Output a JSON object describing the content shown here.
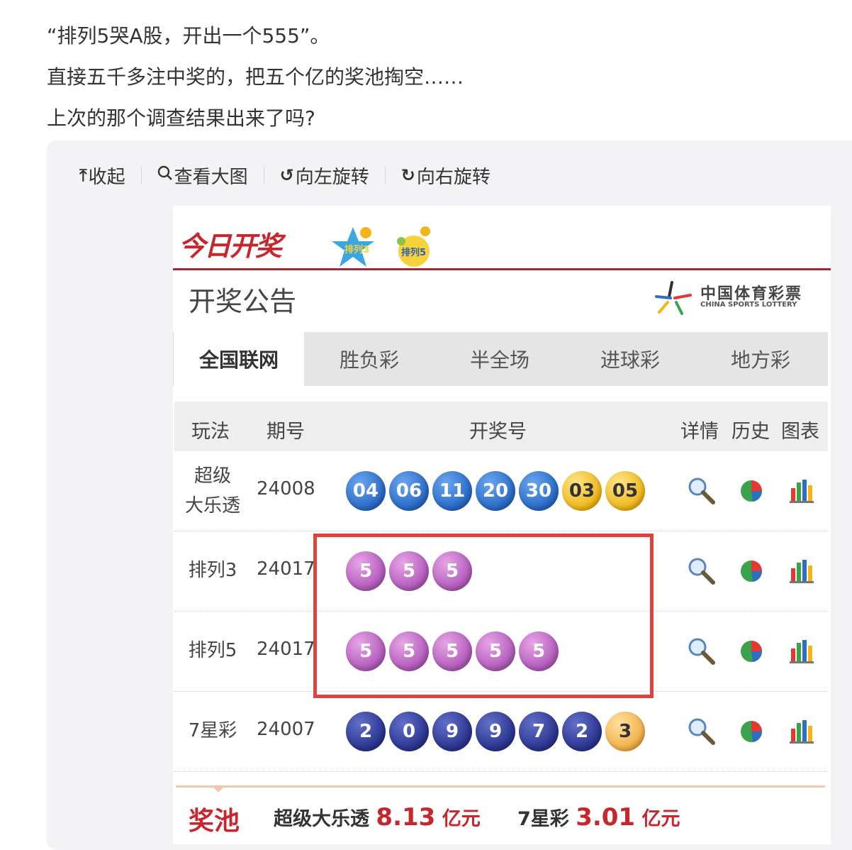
{
  "post": {
    "lines": [
      "“排列5哭A股，开出一个555”。",
      "直接五千多注中奖的，把五个亿的奖池掏空……",
      "上次的那个调查结果出来了吗?"
    ]
  },
  "toolbar": {
    "collapse": "收起",
    "view_large": "查看大图",
    "rotate_left": "向左旋转",
    "rotate_right": "向右旋转"
  },
  "card": {
    "brand": "今日开奖",
    "logo_left": "排列3",
    "logo_right": "排列5",
    "notice_title": "开奖公告",
    "sponsor_cn": "中国体育彩票",
    "sponsor_en": "CHINA SPORTS LOTTERY",
    "tabs": [
      "全国联网",
      "胜负彩",
      "半全场",
      "进球彩",
      "地方彩"
    ],
    "columns": {
      "game": "玩法",
      "issue": "期号",
      "numbers": "开奖号",
      "detail": "详情",
      "history": "历史",
      "chart": "图表"
    },
    "rows": [
      {
        "game_line1": "超级",
        "game_line2": "大乐透",
        "issue": "24008",
        "balls": [
          {
            "n": "04",
            "c": "blue"
          },
          {
            "n": "06",
            "c": "blue"
          },
          {
            "n": "11",
            "c": "blue"
          },
          {
            "n": "20",
            "c": "blue"
          },
          {
            "n": "30",
            "c": "blue"
          },
          {
            "n": "03",
            "c": "gold"
          },
          {
            "n": "05",
            "c": "gold"
          }
        ]
      },
      {
        "game_line1": "排列3",
        "game_line2": "",
        "issue": "24017",
        "balls": [
          {
            "n": "5",
            "c": "purple"
          },
          {
            "n": "5",
            "c": "purple"
          },
          {
            "n": "5",
            "c": "purple"
          }
        ]
      },
      {
        "game_line1": "排列5",
        "game_line2": "",
        "issue": "24017",
        "balls": [
          {
            "n": "5",
            "c": "purple"
          },
          {
            "n": "5",
            "c": "purple"
          },
          {
            "n": "5",
            "c": "purple"
          },
          {
            "n": "5",
            "c": "purple"
          },
          {
            "n": "5",
            "c": "purple"
          }
        ]
      },
      {
        "game_line1": "7星彩",
        "game_line2": "",
        "issue": "24007",
        "balls": [
          {
            "n": "2",
            "c": "navy"
          },
          {
            "n": "0",
            "c": "navy"
          },
          {
            "n": "9",
            "c": "navy"
          },
          {
            "n": "9",
            "c": "navy"
          },
          {
            "n": "7",
            "c": "navy"
          },
          {
            "n": "2",
            "c": "navy"
          },
          {
            "n": "3",
            "c": "orange"
          }
        ]
      }
    ],
    "jackpot": {
      "title": "奖池",
      "dlt_label": "超级大乐透",
      "dlt_amount": "8.13",
      "dlt_unit": "亿元",
      "qxc_label": "7星彩",
      "qxc_amount": "3.01",
      "qxc_unit": "亿元"
    }
  },
  "colors": {
    "brand_red": "#c6262c",
    "highlight_box": "#e0423c",
    "header_rule": "#a52532"
  }
}
